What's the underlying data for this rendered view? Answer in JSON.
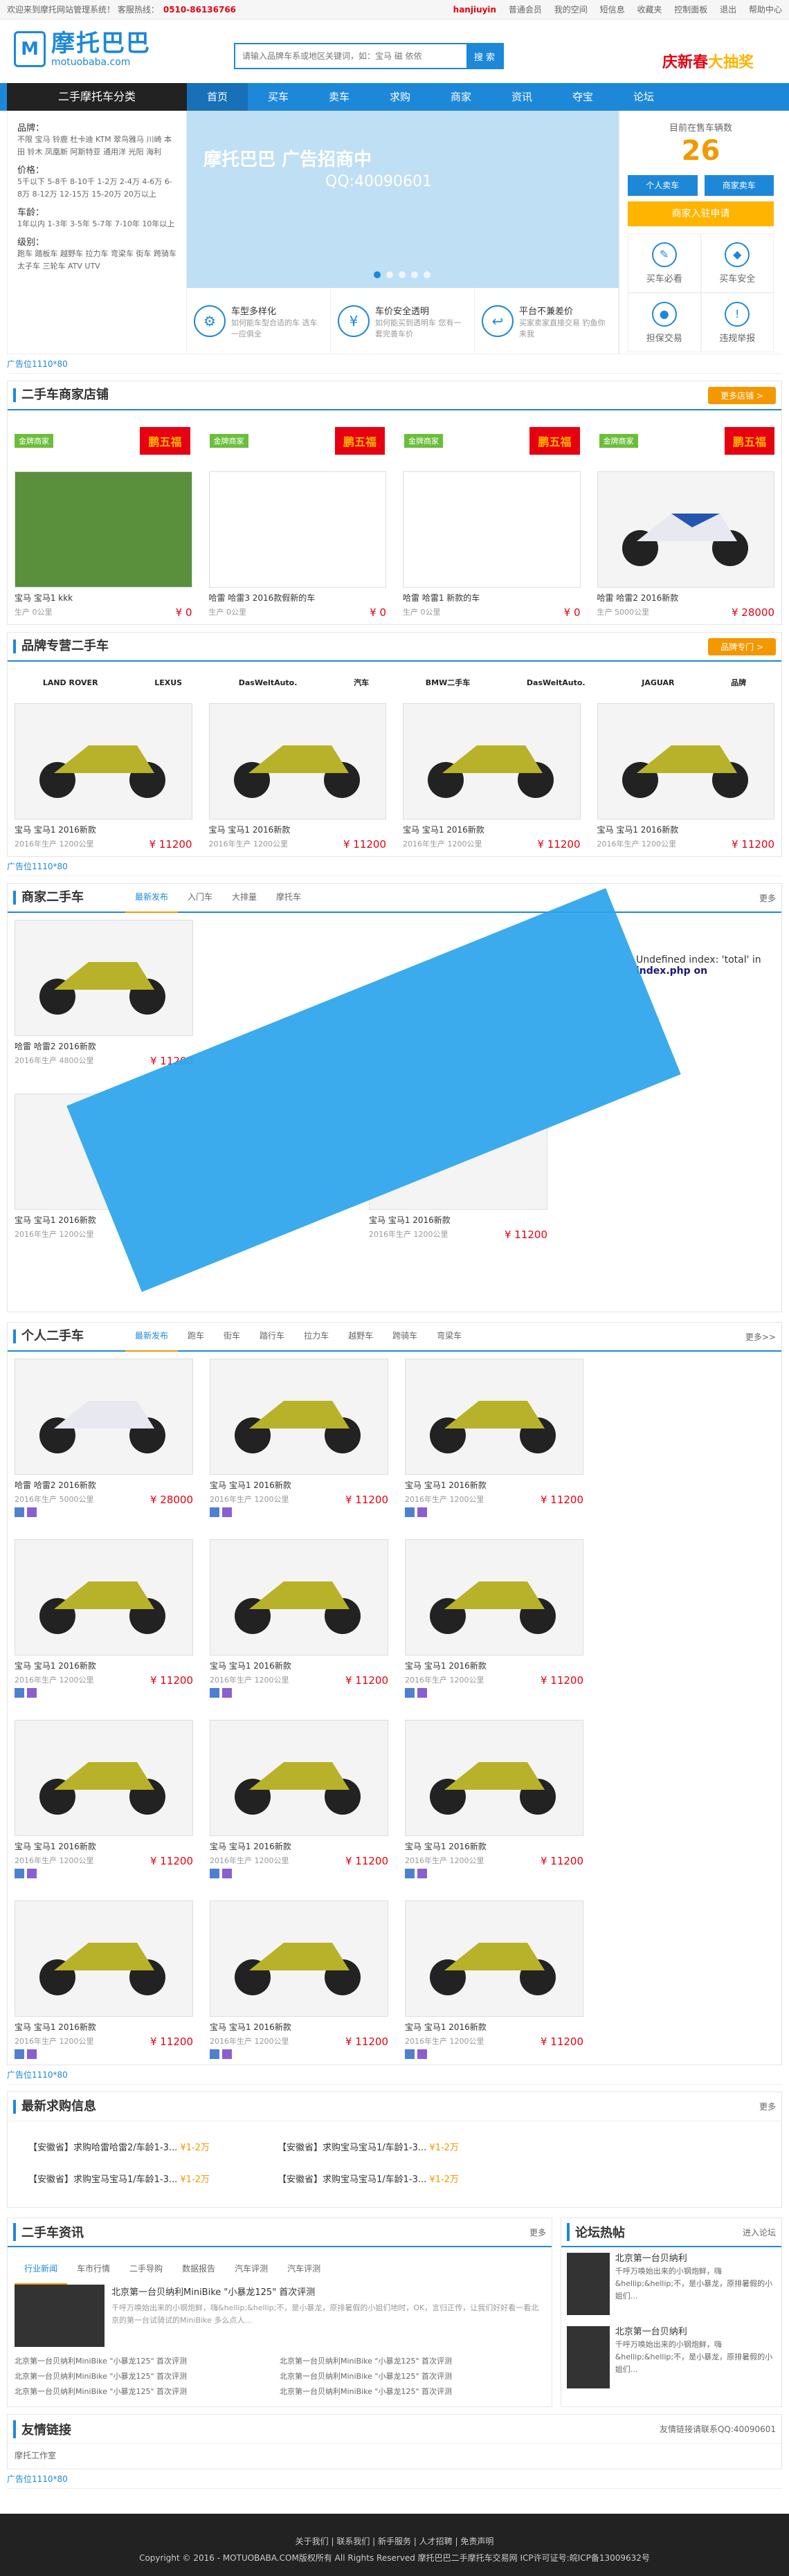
{
  "topbar": {
    "welcome": "欢迎来到摩托网站管理系统！",
    "hotline_label": "客服热线：",
    "phone": "0510-86136766",
    "user": "hanjiuyin",
    "links": [
      "普通会员",
      "我的空间",
      "短信息",
      "收藏夹",
      "控制面板",
      "退出",
      "帮助中心"
    ]
  },
  "header": {
    "logo_cn": "摩托巴巴",
    "logo_en": "motuobaba.com",
    "search_placeholder": "请输入品牌车系或地区关键词，如：宝马 磁 依依",
    "search_button": "搜 索",
    "promo_a": "庆新春",
    "promo_b": "大抽奖"
  },
  "nav": {
    "category": "二手摩托车分类",
    "items": [
      "首页",
      "买车",
      "卖车",
      "求购",
      "商家",
      "资讯",
      "夺宝",
      "论坛"
    ]
  },
  "sidebar": {
    "brand_label": "品牌：",
    "brand_values": "不限 宝马 铃鹿 杜卡迪 KTM 翠鸟雅马 川崎 本田 铃木 凤凰新 阿斯特亚 通用洋 光阳 海利",
    "price_label": "价格：",
    "price_values": "5千以下 5-8千 8-10千 1-2万 2-4万 4-6万 6-8万 8-12万 12-15万 15-20万 20万以上",
    "age_label": "车龄：",
    "age_values": "1年以内 1-3年 3-5年 5-7年 7-10年 10年以上",
    "level_label": "级别：",
    "level_values": "跑车 踏板车 越野车 拉力车 弯梁车 街车 跨骑车 太子车 三轮车 ATV UTV"
  },
  "banner": {
    "title": "摩托巴巴 广告招商中",
    "qq": "QQ:40090601"
  },
  "features": [
    {
      "title": "车型多样化",
      "sub": "如何能车型合适的车 选车一应俱全"
    },
    {
      "title": "车价安全透明",
      "sub": "如何能买到透明车 您有一套完善车价"
    },
    {
      "title": "平台不兼差价",
      "sub": "买家卖家直接交易 钓鱼你来我"
    }
  ],
  "stats": {
    "label": "目前在售车辆数",
    "count": "26",
    "btn_personal": "个人卖车",
    "btn_merchant": "商家卖车",
    "btn_merchant_in": "商家入驻申请",
    "grid": [
      "买车必看",
      "买车安全",
      "担保交易",
      "违规举报"
    ]
  },
  "ad_label": "广告位1110*80",
  "shops": {
    "title": "二手车商家店铺",
    "more": "更多店铺 >",
    "shop_label": "鹏五福",
    "shop_tag": "金牌商家",
    "items": [
      {
        "name": "宝马 宝马1 kkk",
        "meta": "生产 0公里",
        "price": "¥ 0"
      },
      {
        "name": "哈雷 哈雷3 2016款假新的车",
        "meta": "生产 0公里",
        "price": "¥ 0"
      },
      {
        "name": "哈雷 哈雷1 新款的车",
        "meta": "生产 0公里",
        "price": "¥ 0"
      },
      {
        "name": "哈雷 哈雷2 2016新款",
        "meta": "生产 5000公里",
        "price": "¥ 28000"
      }
    ]
  },
  "brands": {
    "title": "品牌专营二手车",
    "more": "品牌专门 >",
    "logos": [
      "LAND ROVER",
      "LEXUS",
      "DasWeltAuto.",
      "汽车",
      "BMW二手车",
      "DasWeltAuto.",
      "JAGUAR",
      "品牌"
    ],
    "items": [
      {
        "name": "宝马 宝马1 2016新款",
        "meta": "2016年生产 1200公里",
        "price": "¥ 11200"
      },
      {
        "name": "宝马 宝马1 2016新款",
        "meta": "2016年生产 1200公里",
        "price": "¥ 11200"
      },
      {
        "name": "宝马 宝马1 2016新款",
        "meta": "2016年生产 1200公里",
        "price": "¥ 11200"
      },
      {
        "name": "宝马 宝马1 2016新款",
        "meta": "2016年生产 1200公里",
        "price": "¥ 11200"
      }
    ]
  },
  "merchant": {
    "title": "商家二手车",
    "tabs": [
      "最新发布",
      "入门车",
      "大排量",
      "摩托车"
    ],
    "more": "更多",
    "row1": [
      {
        "name": "哈雷 哈雷2 2016新款",
        "meta": "2016年生产 4800公里",
        "price": "¥ 11200"
      }
    ],
    "row2": [
      {
        "name": "宝马 宝马1 2016新款",
        "meta": "2016年生产 1200公里",
        "price": ""
      },
      {
        "name": "宝马 宝马1 2016新款",
        "meta": "2016年生产 1200公里",
        "price": "¥ 11200"
      }
    ],
    "error_text": "Undefined index: 'total' in",
    "error_file": "index.php on"
  },
  "personal": {
    "title": "个人二手车",
    "tabs": [
      "最新发布",
      "跑车",
      "街车",
      "踏行车",
      "拉力车",
      "越野车",
      "跨骑车",
      "弯梁车"
    ],
    "more": "更多>>",
    "items": [
      {
        "name": "哈雷 哈雷2 2016新款",
        "meta": "2016年生产 5000公里",
        "price": "¥ 28000"
      },
      {
        "name": "宝马 宝马1 2016新款",
        "meta": "2016年生产 1200公里",
        "price": "¥ 11200"
      },
      {
        "name": "宝马 宝马1 2016新款",
        "meta": "2016年生产 1200公里",
        "price": "¥ 11200"
      },
      {
        "name": "宝马 宝马1 2016新款",
        "meta": "2016年生产 1200公里",
        "price": "¥ 11200"
      },
      {
        "name": "宝马 宝马1 2016新款",
        "meta": "2016年生产 1200公里",
        "price": "¥ 11200"
      },
      {
        "name": "宝马 宝马1 2016新款",
        "meta": "2016年生产 1200公里",
        "price": "¥ 11200"
      },
      {
        "name": "宝马 宝马1 2016新款",
        "meta": "2016年生产 1200公里",
        "price": "¥ 11200"
      },
      {
        "name": "宝马 宝马1 2016新款",
        "meta": "2016年生产 1200公里",
        "price": "¥ 11200"
      },
      {
        "name": "宝马 宝马1 2016新款",
        "meta": "2016年生产 1200公里",
        "price": "¥ 11200"
      },
      {
        "name": "宝马 宝马1 2016新款",
        "meta": "2016年生产 1200公里",
        "price": "¥ 11200"
      },
      {
        "name": "宝马 宝马1 2016新款",
        "meta": "2016年生产 1200公里",
        "price": "¥ 11200"
      },
      {
        "name": "宝马 宝马1 2016新款",
        "meta": "2016年生产 1200公里",
        "price": "¥ 11200"
      }
    ]
  },
  "requests": {
    "title": "最新求购信息",
    "more": "更多",
    "items": [
      {
        "text": "【安徽省】求购哈雷哈雷2/车龄1-3...",
        "price": "¥1-2万"
      },
      {
        "text": "【安徽省】求购宝马宝马1/车龄1-3...",
        "price": "¥1-2万"
      },
      {
        "text": "【安徽省】求购宝马宝马1/车龄1-3...",
        "price": "¥1-2万"
      },
      {
        "text": "【安徽省】求购宝马宝马1/车龄1-3...",
        "price": "¥1-2万"
      }
    ]
  },
  "news": {
    "title": "二手车资讯",
    "more": "更多",
    "tabs": [
      "行业新闻",
      "车市行情",
      "二手导购",
      "数据报告",
      "汽车评测",
      "汽车评测"
    ],
    "headline": "北京第一台贝纳利MiniBike \"小暴龙125\" 首次评测",
    "summary": "千呼万唤始出来的小钢炮鲜，嗨&hellip;&hellip;不，是小暴龙，原排暑假的小姐们地时，OK，言归正传，让我们好好看一看北京的第一台试骑试的MiniBike 多么点人...",
    "list": [
      "北京第一台贝纳利MiniBike \"小暴龙125\" 首次评测",
      "北京第一台贝纳利MiniBike \"小暴龙125\" 首次评测",
      "北京第一台贝纳利MiniBike \"小暴龙125\" 首次评测",
      "北京第一台贝纳利MiniBike \"小暴龙125\" 首次评测",
      "北京第一台贝纳利MiniBike \"小暴龙125\" 首次评测",
      "北京第一台贝纳利MiniBike \"小暴龙125\" 首次评测"
    ]
  },
  "forum": {
    "title": "论坛热帖",
    "more": "进入论坛",
    "items": [
      {
        "title": "北京第一台贝纳利",
        "text": "千呼万唤始出来的小钢炮鲜，嗨&hellip;&hellip;不，是小暴龙，原排暑假的小姐们..."
      },
      {
        "title": "北京第一台贝纳利",
        "text": "千呼万唤始出来的小钢炮鲜，嗨&hellip;&hellip;不，是小暴龙，原排暑假的小姐们..."
      }
    ]
  },
  "links": {
    "title": "友情链接",
    "item": "摩托工作室",
    "contact": "友情链接请联系QQ:40090601"
  },
  "footer": {
    "links": "关于我们 | 联系我们 | 新手服务 | 人才招聘 | 免责声明",
    "copyright": "Copyright © 2016 - MOTUOBABA.COM版权所有 All Rights Reserved 摩托巴巴二手摩托车交易网 ICP许可证号:皖ICP备13009632号"
  },
  "colors": {
    "accent": "#1e88d8",
    "price": "#e60012",
    "orange": "#f39800",
    "nav": "#222222"
  }
}
